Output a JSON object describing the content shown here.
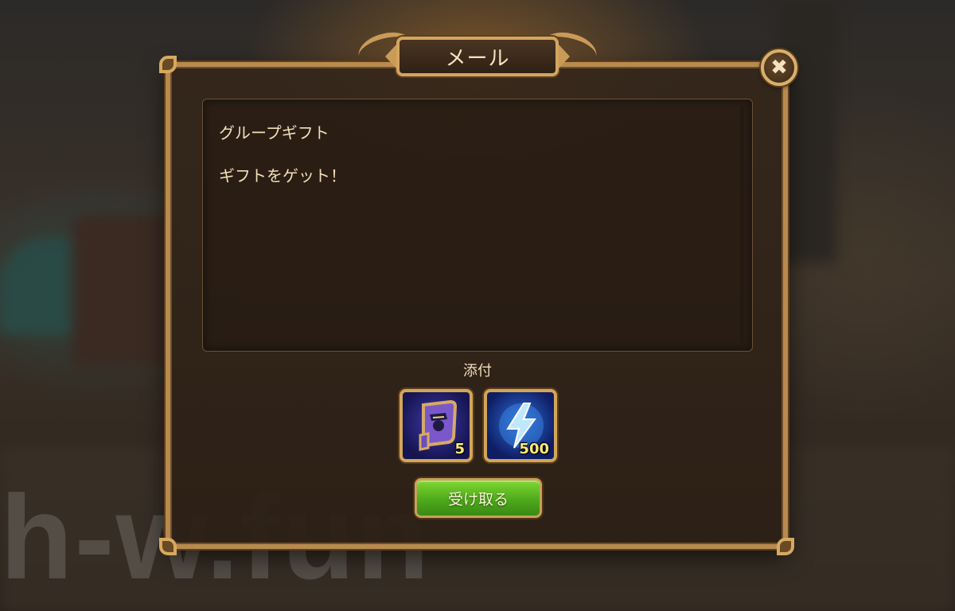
{
  "dialog": {
    "title": "メール",
    "close_icon": "close-icon"
  },
  "message": {
    "subject": "グループギフト",
    "body": "ギフトをゲット！"
  },
  "attachments": {
    "label": "添付",
    "items": [
      {
        "icon": "scroll-hero-icon",
        "count": "5"
      },
      {
        "icon": "lightning-energy-icon",
        "count": "500"
      }
    ]
  },
  "actions": {
    "claim_label": "受け取る"
  },
  "watermark": "h-w.fun",
  "colors": {
    "frame_gold": "#b98a4e",
    "text_cream": "#f2dfbb",
    "claim_green": "#4eaa1c",
    "count_yellow": "#ffe97a"
  }
}
